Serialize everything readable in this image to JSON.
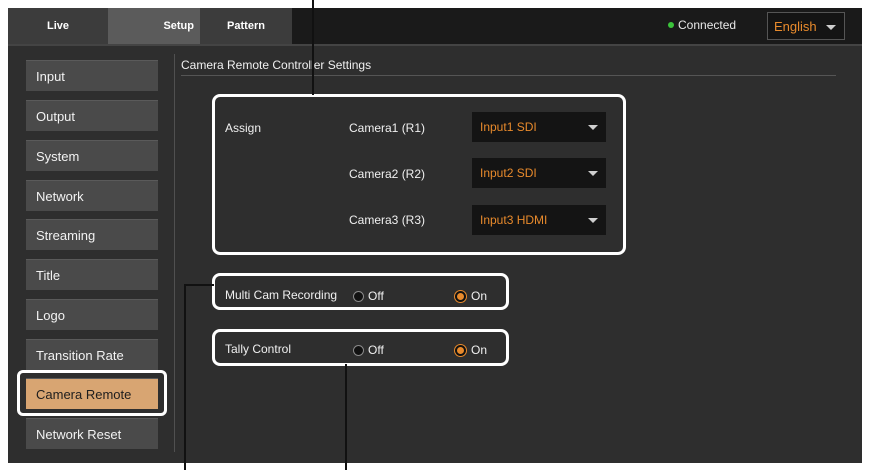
{
  "tabs": {
    "live": "Live",
    "setup": "Setup",
    "pattern": "Pattern"
  },
  "status": {
    "text": "Connected",
    "color": "#3bc43b"
  },
  "language": {
    "value": "English"
  },
  "sidebar": {
    "items": [
      {
        "label": "Input"
      },
      {
        "label": "Output"
      },
      {
        "label": "System"
      },
      {
        "label": "Network"
      },
      {
        "label": "Streaming"
      },
      {
        "label": "Title"
      },
      {
        "label": "Logo"
      },
      {
        "label": "Transition Rate"
      },
      {
        "label": "Camera Remote"
      },
      {
        "label": "Network Reset"
      }
    ],
    "active": "Camera Remote"
  },
  "main": {
    "title": "Camera Remote Controller Settings",
    "assign": {
      "label": "Assign",
      "cameras": [
        {
          "label": "Camera1 (R1)",
          "value": "Input1 SDI"
        },
        {
          "label": "Camera2 (R2)",
          "value": "Input2 SDI"
        },
        {
          "label": "Camera3 (R3)",
          "value": "Input3 HDMI"
        }
      ]
    },
    "multi_cam": {
      "label": "Multi Cam Recording",
      "off": "Off",
      "on": "On",
      "selected": "On"
    },
    "tally": {
      "label": "Tally Control",
      "off": "Off",
      "on": "On",
      "selected": "On"
    }
  },
  "colors": {
    "accent": "#e88a2c",
    "active_item": "#d8a572",
    "highlight_frame": "#ffffff"
  }
}
